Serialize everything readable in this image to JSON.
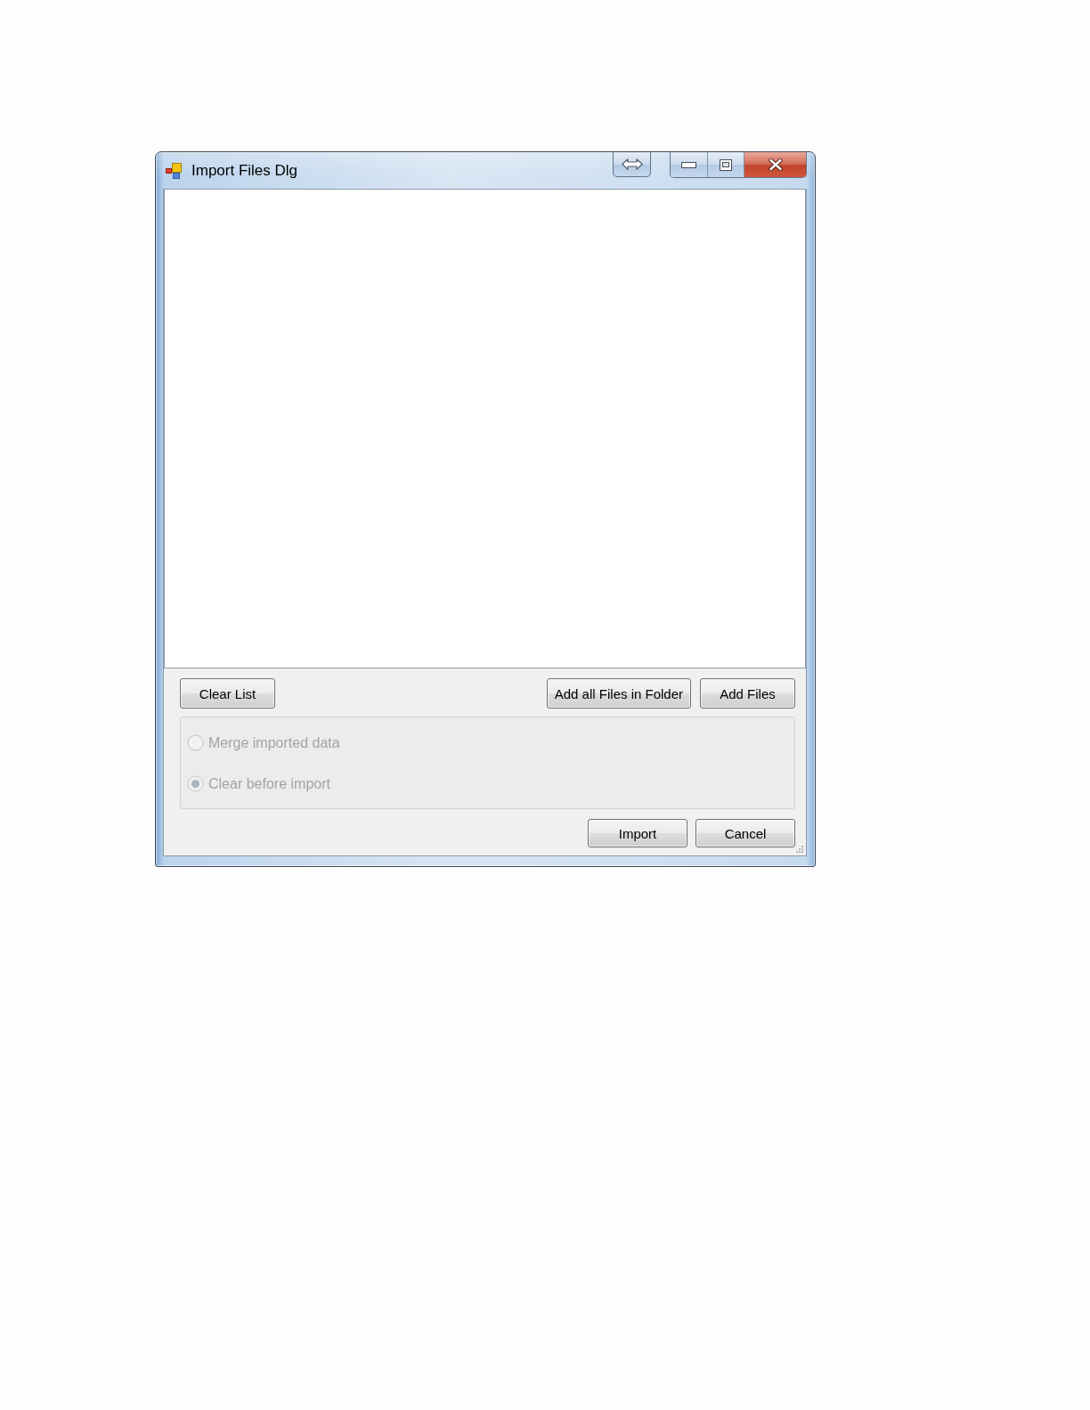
{
  "window": {
    "title": "Import Files Dlg"
  },
  "list_buttons": {
    "left": [
      {
        "label": "Clear List"
      }
    ],
    "right": [
      {
        "label": "Add all Files in Folder"
      },
      {
        "label": "Add Files"
      }
    ]
  },
  "import_mode": {
    "options": [
      {
        "label": "Merge imported data",
        "selected": false,
        "disabled": true
      },
      {
        "label": "Clear before import",
        "selected": true,
        "disabled": true
      }
    ]
  },
  "dialog_buttons": [
    {
      "label": "Import"
    },
    {
      "label": "Cancel"
    }
  ]
}
